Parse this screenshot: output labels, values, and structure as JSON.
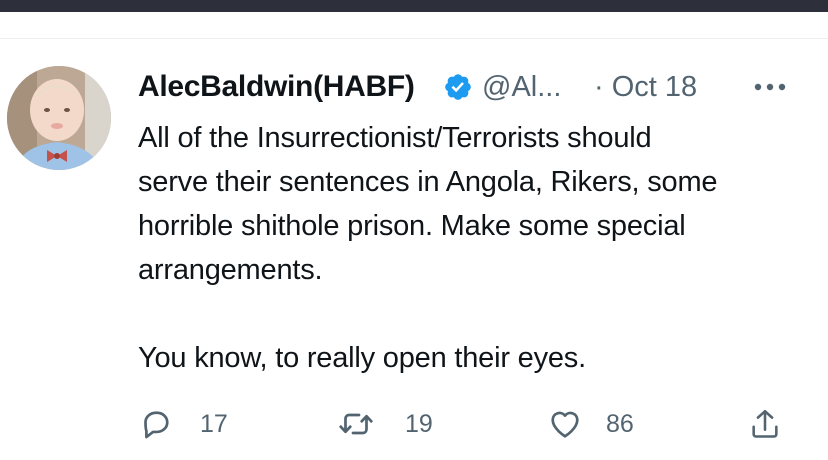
{
  "tweet": {
    "author_name": "AlecBaldwin(HABF)",
    "handle": "@Al...",
    "date": "· Oct 18",
    "text": "All of the Insurrectionist/Terrorists should\nserve their sentences in Angola, Rikers, some\nhorrible shithole prison. Make some special\narrangements.\n\nYou know, to really open their eyes.",
    "verified": true
  },
  "actions": {
    "reply_count": "17",
    "retweet_count": "19",
    "like_count": "86"
  },
  "colors": {
    "verified_blue": "#1d9bf0",
    "muted_text": "#536471",
    "text": "#0f1419",
    "topbar": "#2d2f3a"
  },
  "icons": {
    "verified": "verified-badge-icon",
    "more": "more-options-icon",
    "reply": "reply-icon",
    "retweet": "retweet-icon",
    "like": "heart-icon",
    "share": "share-icon"
  }
}
